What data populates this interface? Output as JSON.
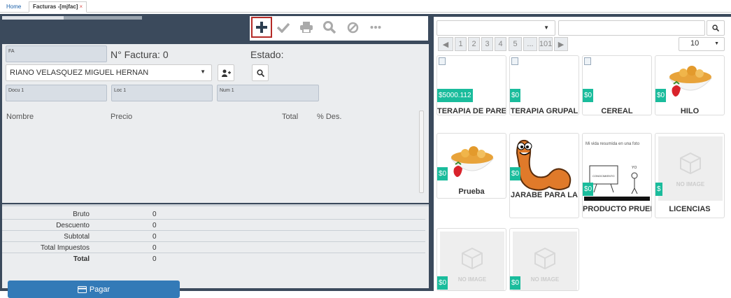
{
  "tabs": [
    {
      "label": "Home"
    },
    {
      "label": "Facturas -[mjfac]",
      "close": "×"
    }
  ],
  "toolbar": {
    "icons": [
      "plus-icon",
      "check-icon",
      "print-icon",
      "search-icon",
      "cancel-icon",
      "more-icon"
    ]
  },
  "form": {
    "prefix": "FA",
    "invoice_label": "N° Factura: 0",
    "status_label": "Estado:",
    "client": "RIANO VELASQUEZ MIGUEL HERNAN",
    "docu_placeholder": "Docu 1",
    "loc_placeholder": "Loc 1",
    "num_placeholder": "Num 1"
  },
  "columns": [
    "Nombre",
    "Precio",
    "Total",
    "% Des."
  ],
  "totals": [
    {
      "label": "Bruto",
      "value": "0"
    },
    {
      "label": "Descuento",
      "value": "0"
    },
    {
      "label": "Subtotal",
      "value": "0"
    },
    {
      "label": "Total Impuestos",
      "value": "0"
    },
    {
      "label": "Total",
      "value": "0"
    }
  ],
  "pay_button": "Pagar",
  "catalog": {
    "category_value": "",
    "search_value": "",
    "page_size": "10",
    "pages": [
      "◀",
      "1",
      "2",
      "3",
      "4",
      "5",
      "...",
      "101",
      "▶"
    ],
    "no_image_text": "NO IMAGE",
    "chart_caption": "Mi vida resumida en una foto",
    "chart_words": [
      "CONOCIMIENTO",
      "YO"
    ],
    "products": [
      {
        "name": "TERAPIA DE PARE",
        "price": "$5000.112",
        "image": "broken"
      },
      {
        "name": "TERAPIA GRUPAL",
        "price": "$0",
        "image": "broken"
      },
      {
        "name": "CEREAL",
        "price": "$0",
        "image": "broken"
      },
      {
        "name": "HILO",
        "price": "$0",
        "image": "cereal"
      },
      {
        "name": "Prueba",
        "price": "$0",
        "image": "cereal"
      },
      {
        "name": "JARABE PARA LA",
        "price": "$0",
        "image": "worm"
      },
      {
        "name": "PRODUCTO PRUEI",
        "price": "$0",
        "image": "chart"
      },
      {
        "name": "LICENCIAS",
        "price": "$",
        "image": "noimage"
      },
      {
        "name": "",
        "price": "$0",
        "image": "noimage"
      },
      {
        "name": "",
        "price": "$0",
        "image": "noimage"
      }
    ]
  },
  "colors": {
    "dark_bg": "#3b4a5c",
    "accent": "#337ab7",
    "price_green": "#1abc9c",
    "selected_border": "#b52b27"
  }
}
